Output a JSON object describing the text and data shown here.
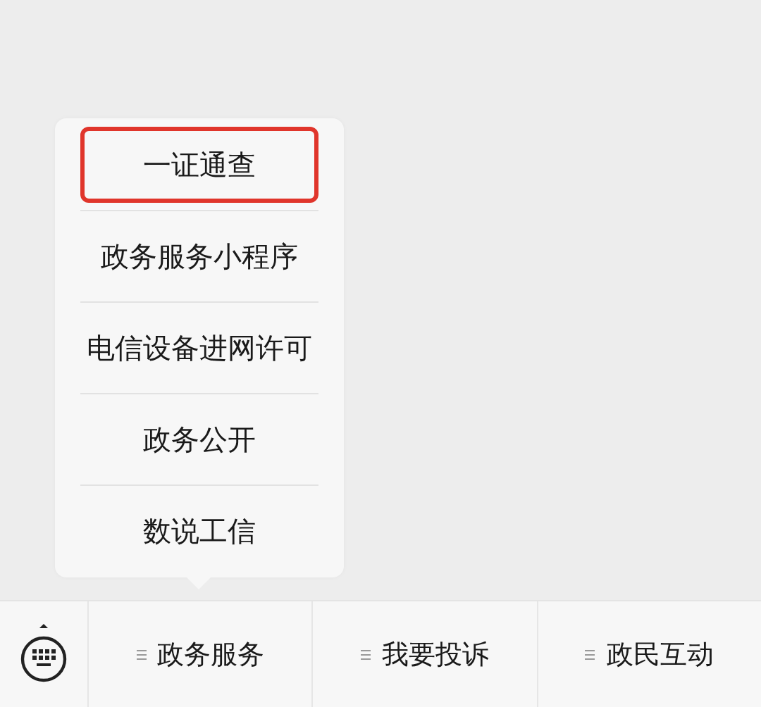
{
  "menu_bar": [
    {
      "label": "政务服务",
      "submenu": [
        {
          "label": "一证通查",
          "highlighted": true
        },
        {
          "label": "政务服务小程序",
          "highlighted": false
        },
        {
          "label": "电信设备进网许可",
          "highlighted": false
        },
        {
          "label": "政务公开",
          "highlighted": false
        },
        {
          "label": "数说工信",
          "highlighted": false
        }
      ]
    },
    {
      "label": "我要投诉"
    },
    {
      "label": "政民互动"
    }
  ]
}
